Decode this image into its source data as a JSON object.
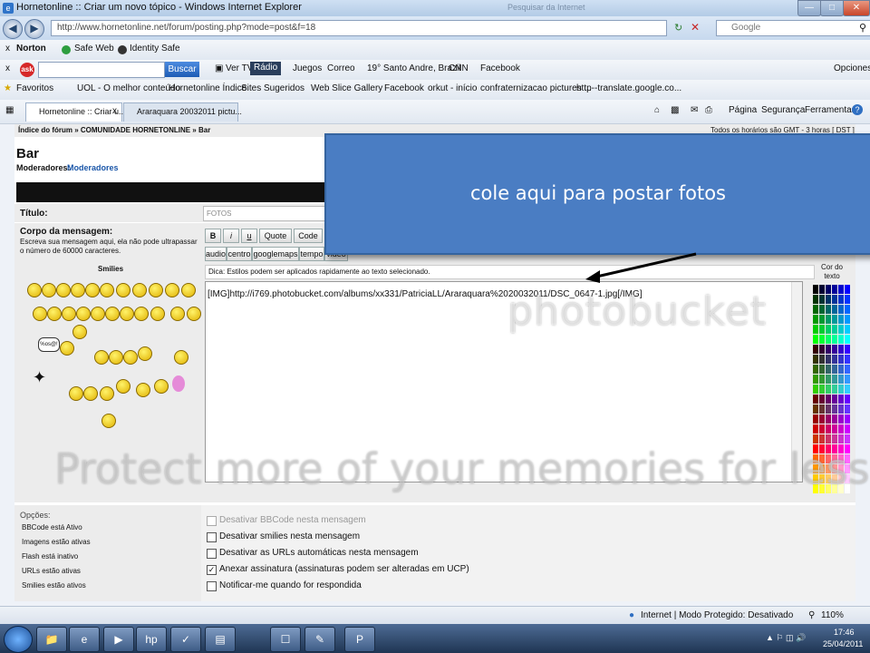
{
  "browser": {
    "window_title": "Hornetonline :: Criar um novo tópico - Windows Internet Explorer",
    "window_title_extra": "Pesquisar da Internet",
    "url": "http://www.hornetonline.net/forum/posting.php?mode=post&f=18",
    "search_placeholder": "Google"
  },
  "norton_bar": {
    "brand": "Norton",
    "safe_web": "Safe Web",
    "identity_safe": "Identity Safe"
  },
  "ask_bar": {
    "search_button": "Buscar",
    "items": [
      "Ver TV",
      "Rádio",
      "Juegos",
      "Correo",
      "19° Santo Andre, Brazil",
      "CNN",
      "Facebook"
    ],
    "options": "Opciones"
  },
  "favorites_bar": {
    "label": "Favoritos",
    "items": [
      "UOL - O melhor conteúdo",
      "Hornetonline Índice",
      "Sites Sugeridos",
      "Web Slice Gallery",
      "Facebook",
      "orkut - início",
      "confraternizacao pictures ...",
      "http--translate.google.co..."
    ]
  },
  "tabs": [
    {
      "label": "Hornetonline :: Criar u..."
    },
    {
      "label": "Araraquara 20032011 pictu..."
    }
  ],
  "command_bar": {
    "page": "Página",
    "security": "Segurança",
    "tools": "Ferramentas"
  },
  "forum": {
    "breadcrumb": "Índice do fórum » COMUNIDADE HORNETONLINE » Bar",
    "timezone": "Todos os horários são GMT - 3 horas [ DST ]",
    "title": "Bar",
    "moderators_label": "Moderadores:",
    "moderators_link": "Moderadores",
    "subject_label": "Título:",
    "subject_value": "FOTOS",
    "body_label": "Corpo da mensagem:",
    "body_hint": "Escreva sua mensagem aqui, ela não pode ultrapassar o número de 60000 caracteres.",
    "smilies_label": "Smilies",
    "bbcode_buttons": [
      "B",
      "i",
      "u",
      "Quote",
      "Code"
    ],
    "bbcode_buttons_2": [
      "audio",
      "centro",
      "googlemaps",
      "tempo",
      "video"
    ],
    "tip": "Dica: Estilos podem ser aplicados rapidamente ao texto selecionado.",
    "message_text": "[IMG]http://i769.photobucket.com/albums/xx331/PatriciaLL/Araraquara%2020032011/DSC_0647-1.jpg[/IMG]",
    "color_label": "Cor do texto",
    "options_label": "Opções:",
    "option_info": [
      "BBCode está Ativo",
      "Imagens estão ativas",
      "Flash está inativo",
      "URLs estão ativas",
      "Smilies estão ativos"
    ],
    "checkboxes": [
      {
        "label": "Desativar BBCode nesta mensagem",
        "checked": false
      },
      {
        "label": "Desativar smilies nesta mensagem",
        "checked": false
      },
      {
        "label": "Desativar as URLs automáticas nesta mensagem",
        "checked": false
      },
      {
        "label": "Anexar assinatura (assinaturas podem ser alteradas em UCP)",
        "checked": true
      },
      {
        "label": "Notificar-me quando for respondida",
        "checked": false
      }
    ]
  },
  "callout": {
    "text": "cole aqui para postar fotos"
  },
  "watermark": {
    "logo": "photobucket",
    "text": "Protect more of your memories for less!"
  },
  "status_bar": {
    "zone": "Internet | Modo Protegido: Desativado",
    "zoom": "110%"
  },
  "taskbar": {
    "time": "17:46",
    "date": "25/04/2011"
  },
  "colors": {
    "callout_bg": "#4a7dc3",
    "title_bar": "#b3cbe6",
    "taskbar": "#1f3553"
  }
}
